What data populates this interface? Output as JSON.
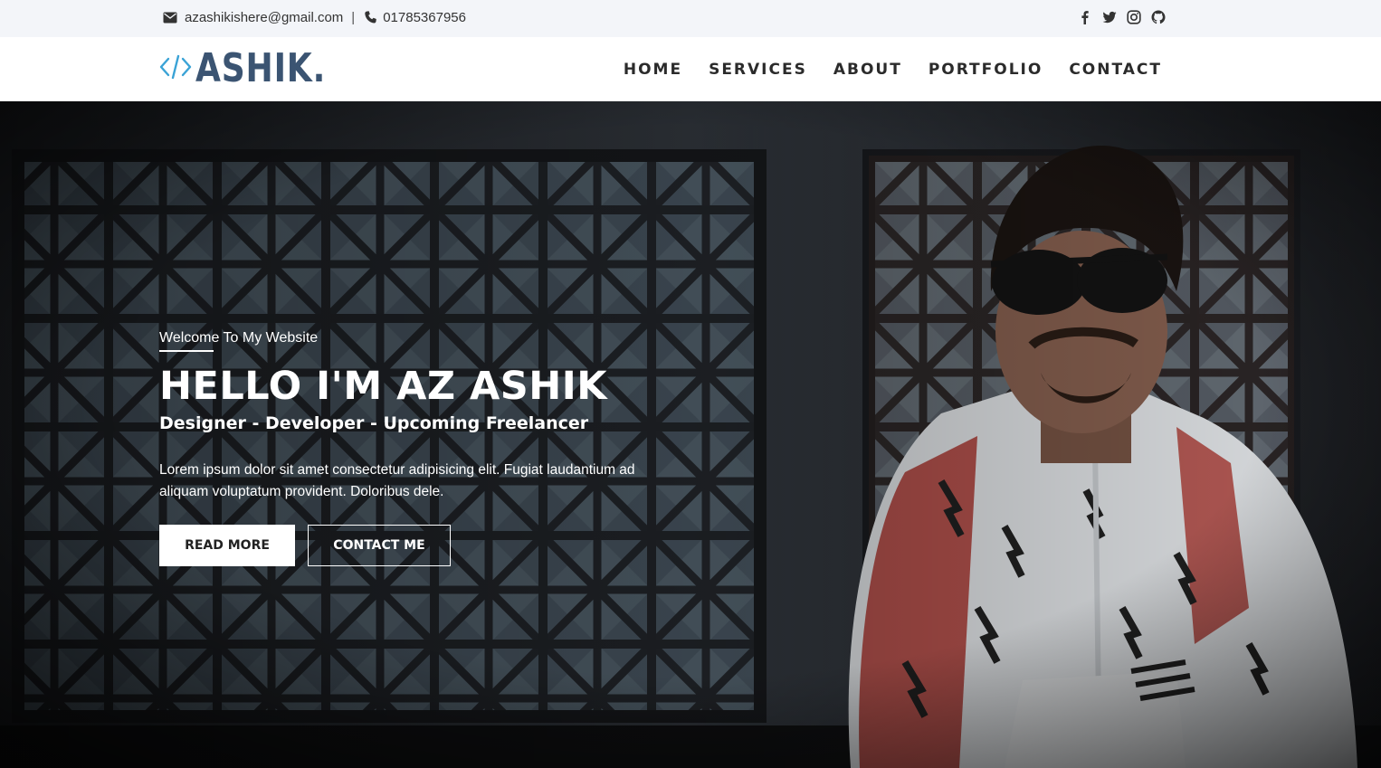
{
  "topbar": {
    "email": "azashikishere@gmail.com",
    "separator": "|",
    "phone": "01785367956",
    "social_icons": [
      "facebook-icon",
      "twitter-icon",
      "instagram-icon",
      "github-icon"
    ]
  },
  "nav": {
    "logo_text": "ASHIK.",
    "items": [
      "HOME",
      "SERVICES",
      "ABOUT",
      "PORTFOLIO",
      "CONTACT"
    ]
  },
  "hero": {
    "welcome": "Welcome To My Website",
    "headline": "HELLO I'M AZ ASHIK",
    "subtitle": "Designer - Developer - Upcoming Freelancer",
    "description": "Lorem ipsum dolor sit amet consectetur adipisicing elit. Fugiat laudantium ad aliquam voluptatum provident. Doloribus dele.",
    "primary_button": "READ MORE",
    "secondary_button": "CONTACT ME"
  },
  "colors": {
    "brand": "#3b5472",
    "logo_accent": "#3aa3d6",
    "topbar_bg": "#f3f5f9",
    "nav_text": "#2b2b2b"
  }
}
